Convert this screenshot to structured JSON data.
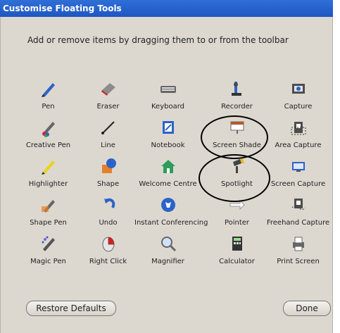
{
  "window": {
    "title": "Customise Floating Tools"
  },
  "instructions": "Add or remove items by dragging them to or from the toolbar",
  "tools": [
    {
      "id": "pen",
      "label": "Pen",
      "icon": "pen-icon"
    },
    {
      "id": "eraser",
      "label": "Eraser",
      "icon": "eraser-icon"
    },
    {
      "id": "keyboard",
      "label": "Keyboard",
      "icon": "keyboard-icon"
    },
    {
      "id": "recorder",
      "label": "Recorder",
      "icon": "recorder-icon"
    },
    {
      "id": "capture",
      "label": "Capture",
      "icon": "capture-icon"
    },
    {
      "id": "creative-pen",
      "label": "Creative Pen",
      "icon": "creative-pen-icon"
    },
    {
      "id": "line",
      "label": "Line",
      "icon": "line-icon"
    },
    {
      "id": "notebook",
      "label": "Notebook",
      "icon": "notebook-icon"
    },
    {
      "id": "screen-shade",
      "label": "Screen Shade",
      "icon": "screen-shade-icon"
    },
    {
      "id": "area-capture",
      "label": "Area Capture",
      "icon": "area-capture-icon"
    },
    {
      "id": "highlighter",
      "label": "Highlighter",
      "icon": "highlighter-icon"
    },
    {
      "id": "shape",
      "label": "Shape",
      "icon": "shape-icon"
    },
    {
      "id": "welcome-centre",
      "label": "Welcome Centre",
      "icon": "welcome-centre-icon"
    },
    {
      "id": "spotlight",
      "label": "Spotlight",
      "icon": "spotlight-icon"
    },
    {
      "id": "screen-capture",
      "label": "Screen Capture",
      "icon": "screen-capture-icon"
    },
    {
      "id": "shape-pen",
      "label": "Shape Pen",
      "icon": "shape-pen-icon"
    },
    {
      "id": "undo",
      "label": "Undo",
      "icon": "undo-icon"
    },
    {
      "id": "instant-conferencing",
      "label": "Instant Conferencing",
      "icon": "instant-conferencing-icon"
    },
    {
      "id": "pointer",
      "label": "Pointer",
      "icon": "pointer-icon"
    },
    {
      "id": "freehand-capture",
      "label": "Freehand Capture",
      "icon": "freehand-capture-icon"
    },
    {
      "id": "magic-pen",
      "label": "Magic Pen",
      "icon": "magic-pen-icon"
    },
    {
      "id": "right-click",
      "label": "Right Click",
      "icon": "right-click-icon"
    },
    {
      "id": "magnifier",
      "label": "Magnifier",
      "icon": "magnifier-icon"
    },
    {
      "id": "calculator",
      "label": "Calculator",
      "icon": "calculator-icon"
    },
    {
      "id": "print-screen",
      "label": "Print Screen",
      "icon": "print-screen-icon"
    }
  ],
  "buttons": {
    "restore": "Restore Defaults",
    "done": "Done"
  }
}
